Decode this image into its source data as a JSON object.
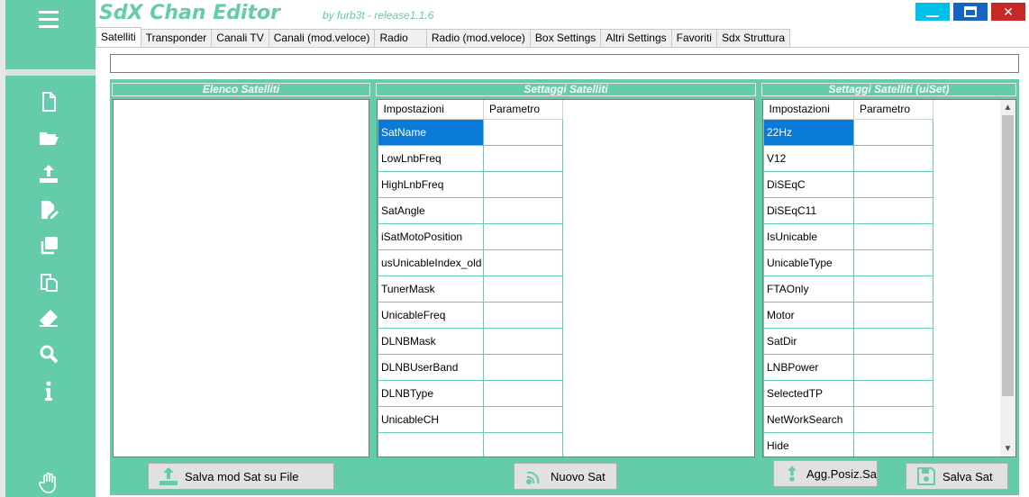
{
  "app": {
    "title": "SdX Chan Editor",
    "subtitle": "by furb3t - release1.1.6",
    "accent": "#64ccaa"
  },
  "sidebar": {
    "icons": [
      "menu-icon",
      "new-file-icon",
      "open-folder-icon",
      "upload-icon",
      "edit-file-icon",
      "copy-icon",
      "paste-icon",
      "eraser-icon",
      "search-icon",
      "info-icon",
      "hand-icon"
    ]
  },
  "window_controls": {
    "minimize": "—",
    "close": "✕"
  },
  "tabs": [
    {
      "label": "Satelliti"
    },
    {
      "label": "Transponder"
    },
    {
      "label": "Canali TV"
    },
    {
      "label": "Canali (mod.veloce)"
    },
    {
      "label": "Radio"
    },
    {
      "label": "Radio (mod.veloce)"
    },
    {
      "label": "Box Settings"
    },
    {
      "label": "Altri Settings"
    },
    {
      "label": "Favoriti"
    },
    {
      "label": "Sdx Struttura"
    }
  ],
  "panels": {
    "list_title": "Elenco Satelliti",
    "settings_title": "Settaggi Satelliti",
    "uiset_title": "Settaggi Satelliti (uiSet)"
  },
  "settings_table": {
    "headers": [
      "Impostazioni",
      "Parametro"
    ],
    "rows": [
      "SatName",
      "LowLnbFreq",
      "HighLnbFreq",
      "SatAngle",
      "iSatMotoPosition",
      "usUnicableIndex_old",
      "TunerMask",
      "UnicableFreq",
      "DLNBMask",
      "DLNBUserBand",
      "DLNBType",
      "UnicableCH",
      ""
    ]
  },
  "uiset_table": {
    "headers": [
      "Impostazioni",
      "Parametro"
    ],
    "rows": [
      "22Hz",
      "V12",
      "DiSEqC",
      "DiSEqC11",
      "IsUnicable",
      "UnicableType",
      "FTAOnly",
      "Motor",
      "SatDir",
      "LNBPower",
      "SelectedTP",
      "NetWorkSearch",
      "Hide"
    ]
  },
  "buttons": {
    "save_file": "Salva mod Sat su File",
    "new_sat": "Nuovo Sat",
    "update_pos": "Agg.Posiz.Sa",
    "save_sat": "Salva Sat"
  }
}
